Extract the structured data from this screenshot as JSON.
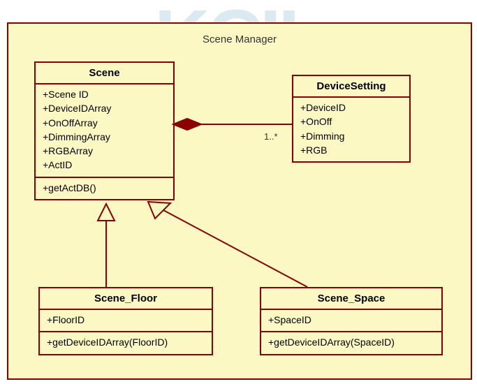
{
  "package": {
    "title": "Scene Manager"
  },
  "watermark": "KCIL",
  "classes": {
    "scene": {
      "name": "Scene",
      "attributes": [
        "+Scene ID",
        "+DeviceIDArray",
        "+OnOffArray",
        "+DimmingArray",
        "+RGBArray",
        "+ActID"
      ],
      "methods": [
        "+getActDB()"
      ]
    },
    "deviceSetting": {
      "name": "DeviceSetting",
      "attributes": [
        "+DeviceID",
        "+OnOff",
        "+Dimming",
        "+RGB"
      ]
    },
    "sceneFloor": {
      "name": "Scene_Floor",
      "attributes": [
        "+FloorID"
      ],
      "methods": [
        "+getDeviceIDArray(FloorID)"
      ]
    },
    "sceneSpace": {
      "name": "Scene_Space",
      "attributes": [
        "+SpaceID"
      ],
      "methods": [
        "+getDeviceIDArray(SpaceID)"
      ]
    }
  },
  "multiplicity": {
    "deviceSetting": "1..*"
  },
  "chart_data": {
    "type": "uml-class-diagram",
    "package": "Scene Manager",
    "classes": [
      {
        "name": "Scene",
        "attributes": [
          "Scene ID",
          "DeviceIDArray",
          "OnOffArray",
          "DimmingArray",
          "RGBArray",
          "ActID"
        ],
        "methods": [
          "getActDB()"
        ]
      },
      {
        "name": "DeviceSetting",
        "attributes": [
          "DeviceID",
          "OnOff",
          "Dimming",
          "RGB"
        ],
        "methods": []
      },
      {
        "name": "Scene_Floor",
        "attributes": [
          "FloorID"
        ],
        "methods": [
          "getDeviceIDArray(FloorID)"
        ]
      },
      {
        "name": "Scene_Space",
        "attributes": [
          "SpaceID"
        ],
        "methods": [
          "getDeviceIDArray(SpaceID)"
        ]
      }
    ],
    "relationships": [
      {
        "from": "Scene",
        "to": "DeviceSetting",
        "type": "composition",
        "multiplicity_to": "1..*"
      },
      {
        "from": "Scene_Floor",
        "to": "Scene",
        "type": "generalization"
      },
      {
        "from": "Scene_Space",
        "to": "Scene",
        "type": "generalization"
      }
    ]
  }
}
